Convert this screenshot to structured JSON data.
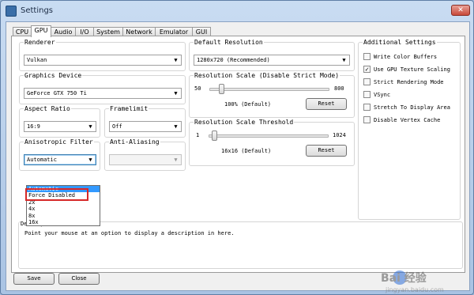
{
  "window": {
    "title": "Settings",
    "close_glyph": "✕"
  },
  "tabs": [
    "CPU",
    "GPU",
    "Audio",
    "I/O",
    "System",
    "Network",
    "Emulator",
    "GUI"
  ],
  "active_tab": "GPU",
  "renderer": {
    "label": "Renderer",
    "value": "Vulkan"
  },
  "graphics_device": {
    "label": "Graphics Device",
    "value": "GeForce GTX 750 Ti"
  },
  "aspect_ratio": {
    "label": "Aspect Ratio",
    "value": "16:9"
  },
  "framelimit": {
    "label": "Framelimit",
    "value": "Off"
  },
  "anisotropic": {
    "label": "Anisotropic Filter",
    "value": "Automatic",
    "options": [
      "Automatic",
      "Force Disabled",
      "2x",
      "4x",
      "8x",
      "16x"
    ],
    "highlighted_index": 0,
    "marked_option": "Force Disabled"
  },
  "anti_aliasing": {
    "label": "Anti-Aliasing",
    "value": ""
  },
  "default_resolution": {
    "label": "Default Resolution",
    "value": "1280x720 (Recommended)"
  },
  "resolution_scale": {
    "label": "Resolution Scale (Disable Strict Mode)",
    "min": "50",
    "max": "800",
    "value_text": "100% (Default)",
    "value": 100,
    "range": [
      50,
      800
    ],
    "reset_label": "Reset"
  },
  "resolution_scale_threshold": {
    "label": "Resolution Scale Threshold",
    "min": "1",
    "max": "1024",
    "value_text": "16x16 (Default)",
    "value": 16,
    "range": [
      1,
      1024
    ],
    "reset_label": "Reset"
  },
  "additional_settings": {
    "label": "Additional Settings",
    "items": [
      {
        "label": "Write Color Buffers",
        "checked": false
      },
      {
        "label": "Use GPU Texture Scaling",
        "checked": true
      },
      {
        "label": "Strict Rendering Mode",
        "checked": false
      },
      {
        "label": "VSync",
        "checked": false
      },
      {
        "label": "Stretch To Display Area",
        "checked": false
      },
      {
        "label": "Disable Vertex Cache",
        "checked": false
      }
    ]
  },
  "description": {
    "label": "Description",
    "text": "Point your mouse at an option to display a description in here."
  },
  "buttons": {
    "save": "Save",
    "close": "Close"
  },
  "watermark": {
    "text": "Bai 经验",
    "subtext": "jingyan.baidu.com"
  },
  "colors": {
    "selection": "#3399ff",
    "marker": "#d62828"
  },
  "icons": {
    "arrow": "▼",
    "check": "✓"
  }
}
